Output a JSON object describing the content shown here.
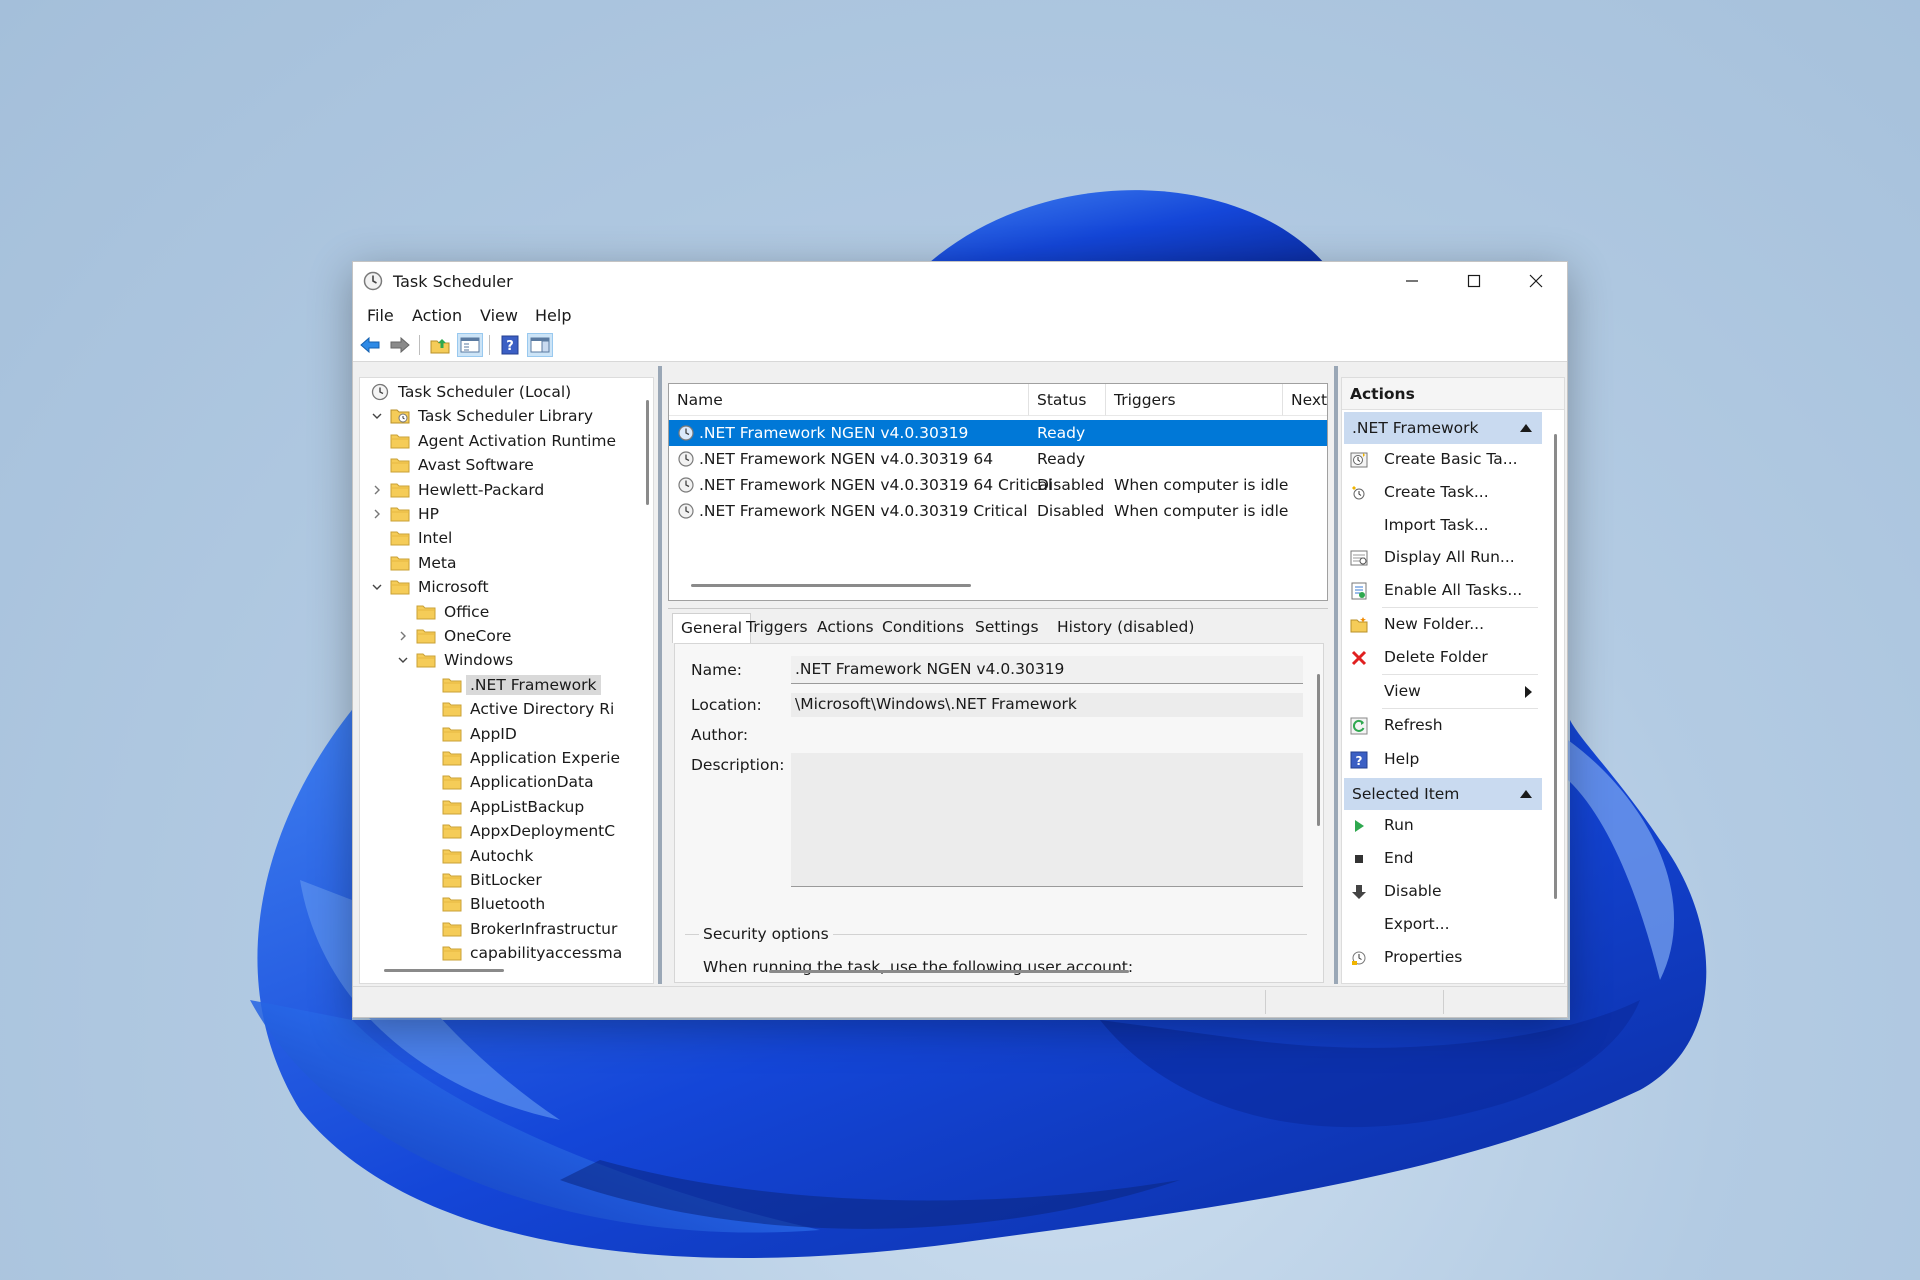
{
  "window": {
    "title": "Task Scheduler",
    "controls": {
      "minimize": "minimize-icon",
      "maximize": "maximize-icon",
      "close": "close-icon"
    }
  },
  "menu": [
    "File",
    "Action",
    "View",
    "Help"
  ],
  "toolbar": {
    "icons": [
      "back-arrow-icon",
      "forward-arrow-icon",
      "up-folder-icon",
      "show-hide-console-tree-icon",
      "help-icon",
      "show-hide-action-pane-icon"
    ]
  },
  "tree": {
    "nodes": [
      {
        "label": "Task Scheduler (Local)",
        "level": 0,
        "expander": "none",
        "icon": "clock"
      },
      {
        "label": "Task Scheduler Library",
        "level": 0,
        "expander": "expanded",
        "icon": "library"
      },
      {
        "label": "Agent Activation Runtime",
        "level": 1,
        "expander": "none",
        "icon": "folder"
      },
      {
        "label": "Avast Software",
        "level": 1,
        "expander": "none",
        "icon": "folder"
      },
      {
        "label": "Hewlett-Packard",
        "level": 1,
        "expander": "collapsed",
        "icon": "folder"
      },
      {
        "label": "HP",
        "level": 1,
        "expander": "collapsed",
        "icon": "folder"
      },
      {
        "label": "Intel",
        "level": 1,
        "expander": "none",
        "icon": "folder"
      },
      {
        "label": "Meta",
        "level": 1,
        "expander": "none",
        "icon": "folder"
      },
      {
        "label": "Microsoft",
        "level": 1,
        "expander": "expanded",
        "icon": "folder"
      },
      {
        "label": "Office",
        "level": 2,
        "expander": "none",
        "icon": "folder"
      },
      {
        "label": "OneCore",
        "level": 2,
        "expander": "collapsed",
        "icon": "folder"
      },
      {
        "label": "Windows",
        "level": 2,
        "expander": "expanded",
        "icon": "folder"
      },
      {
        "label": ".NET Framework",
        "level": 3,
        "expander": "none",
        "icon": "folder",
        "selected": true
      },
      {
        "label": "Active Directory Ri",
        "level": 3,
        "expander": "none",
        "icon": "folder"
      },
      {
        "label": "AppID",
        "level": 3,
        "expander": "none",
        "icon": "folder"
      },
      {
        "label": "Application Experie",
        "level": 3,
        "expander": "none",
        "icon": "folder"
      },
      {
        "label": "ApplicationData",
        "level": 3,
        "expander": "none",
        "icon": "folder"
      },
      {
        "label": "AppListBackup",
        "level": 3,
        "expander": "none",
        "icon": "folder"
      },
      {
        "label": "AppxDeploymentC",
        "level": 3,
        "expander": "none",
        "icon": "folder"
      },
      {
        "label": "Autochk",
        "level": 3,
        "expander": "none",
        "icon": "folder"
      },
      {
        "label": "BitLocker",
        "level": 3,
        "expander": "none",
        "icon": "folder"
      },
      {
        "label": "Bluetooth",
        "level": 3,
        "expander": "none",
        "icon": "folder"
      },
      {
        "label": "BrokerInfrastructur",
        "level": 3,
        "expander": "none",
        "icon": "folder"
      },
      {
        "label": "capabilityaccessma",
        "level": 3,
        "expander": "none",
        "icon": "folder"
      }
    ]
  },
  "task_list": {
    "columns": [
      "Name",
      "Status",
      "Triggers",
      "Next"
    ],
    "rows": [
      {
        "name": ".NET Framework NGEN v4.0.30319",
        "status": "Ready",
        "triggers": "",
        "selected": true
      },
      {
        "name": ".NET Framework NGEN v4.0.30319 64",
        "status": "Ready",
        "triggers": ""
      },
      {
        "name": ".NET Framework NGEN v4.0.30319 64 Critical",
        "status": "Disabled",
        "triggers": "When computer is idle"
      },
      {
        "name": ".NET Framework NGEN v4.0.30319 Critical",
        "status": "Disabled",
        "triggers": "When computer is idle"
      }
    ]
  },
  "detail": {
    "tabs": [
      "General",
      "Triggers",
      "Actions",
      "Conditions",
      "Settings",
      "History (disabled)"
    ],
    "active_tab": "General",
    "fields": {
      "name_label": "Name:",
      "name_value": ".NET Framework NGEN v4.0.30319",
      "location_label": "Location:",
      "location_value": "\\Microsoft\\Windows\\.NET Framework",
      "author_label": "Author:",
      "author_value": "",
      "description_label": "Description:",
      "description_value": ""
    },
    "security": {
      "title": "Security options",
      "text": "When running the task, use the following user account:"
    }
  },
  "actions_pane": {
    "title": "Actions",
    "sections": [
      {
        "title": ".NET Framework",
        "items": [
          {
            "label": "Create Basic Ta...",
            "icon": "create-basic-task-icon"
          },
          {
            "label": "Create Task...",
            "icon": "create-task-icon"
          },
          {
            "label": "Import Task...",
            "icon": ""
          },
          {
            "label": "Display All Run...",
            "icon": "display-running-tasks-icon"
          },
          {
            "label": "Enable All Tasks...",
            "icon": "enable-history-icon"
          },
          {
            "label": "New Folder...",
            "icon": "new-folder-icon"
          },
          {
            "label": "Delete Folder",
            "icon": "delete-icon"
          },
          {
            "label": "View",
            "icon": "",
            "submenu": true
          },
          {
            "label": "Refresh",
            "icon": "refresh-icon"
          },
          {
            "label": "Help",
            "icon": "help-icon"
          }
        ]
      },
      {
        "title": "Selected Item",
        "items": [
          {
            "label": "Run",
            "icon": "run-icon"
          },
          {
            "label": "End",
            "icon": "end-icon"
          },
          {
            "label": "Disable",
            "icon": "disable-icon"
          },
          {
            "label": "Export...",
            "icon": ""
          },
          {
            "label": "Properties",
            "icon": "properties-icon"
          }
        ]
      }
    ]
  },
  "colors": {
    "selection": "#0078d7",
    "section_header": "#c9daf0",
    "wallpaper_blue": "#1a4fd6",
    "folder_yellow": "#f5cc58"
  }
}
